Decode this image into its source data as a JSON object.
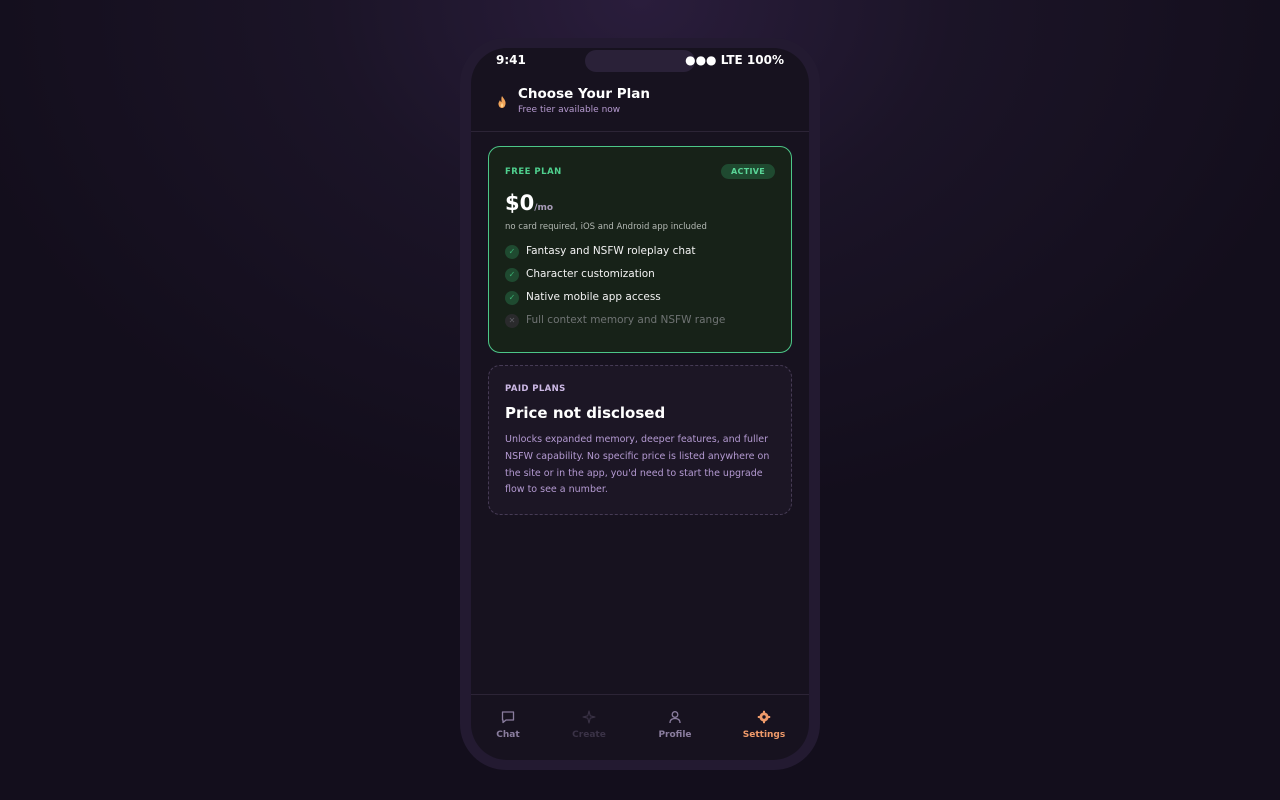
{
  "status_bar": {
    "time": "9:41",
    "indicators": "●●● LTE 100%"
  },
  "header": {
    "icon": "flame-icon",
    "title": "Choose Your Plan",
    "subtitle": "Free tier available now"
  },
  "free_plan": {
    "label": "FREE PLAN",
    "badge": "ACTIVE",
    "price": "$0",
    "price_unit": "/mo",
    "note": "no card required, iOS and Android app included",
    "features": [
      {
        "text": "Fantasy and NSFW roleplay chat",
        "included": true
      },
      {
        "text": "Character customization",
        "included": true
      },
      {
        "text": "Native mobile app access",
        "included": true
      },
      {
        "text": "Full context memory and NSFW range",
        "included": false
      }
    ],
    "accent_color": "#4cc688"
  },
  "paid_plans": {
    "label": "PAID PLANS",
    "price": "Price not disclosed",
    "description": "Unlocks expanded memory, deeper features, and fuller NSFW capability. No specific price is listed anywhere on the site or in the app, you'd need to start the upgrade flow to see a number."
  },
  "tab_bar": {
    "tabs": [
      {
        "label": "Chat",
        "icon": "chat-bubble-icon",
        "state": "normal"
      },
      {
        "label": "Create",
        "icon": "sparkle-icon",
        "state": "disabled"
      },
      {
        "label": "Profile",
        "icon": "person-icon",
        "state": "normal"
      },
      {
        "label": "Settings",
        "icon": "gear-icon",
        "state": "active"
      }
    ],
    "active_color": "#ef9a6a"
  }
}
